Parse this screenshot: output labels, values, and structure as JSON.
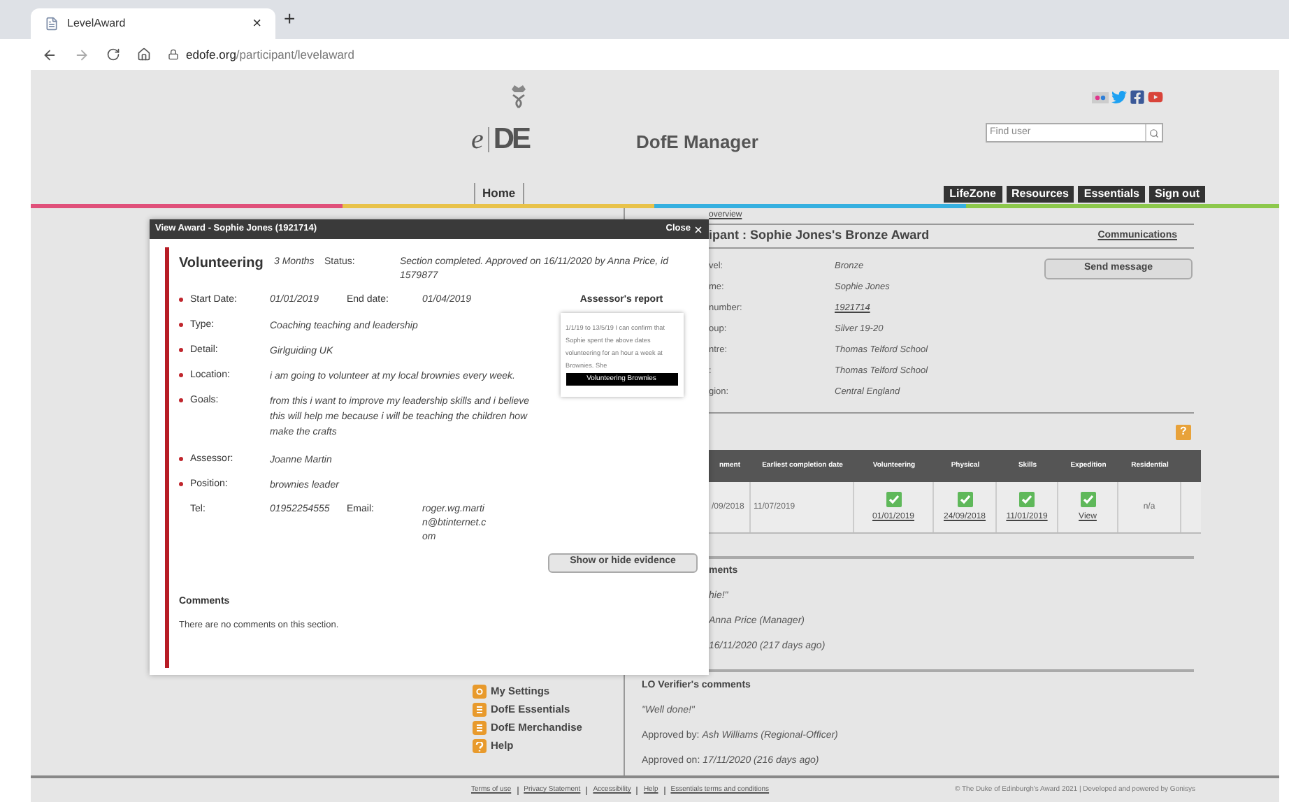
{
  "browser": {
    "tab_title": "LevelAward",
    "close": "×",
    "new_tab": "+",
    "address": {
      "domain": "edofe.org",
      "path": "/participant/levelaward"
    }
  },
  "header": {
    "logo": {
      "letter": "e",
      "mark": "DE"
    },
    "title": "DofE Manager",
    "search": {
      "placeholder": "Find user"
    }
  },
  "nav": {
    "home": "Home",
    "buttons": [
      "LifeZone",
      "Resources",
      "Essentials",
      "Sign out"
    ]
  },
  "breadcrumb": "overview",
  "sidebar": {
    "items": [
      {
        "label": "My Settings",
        "kind": "settings"
      },
      {
        "label": "DofE Essentials",
        "kind": "doc"
      },
      {
        "label": "DofE Merchandise",
        "kind": "doc"
      },
      {
        "label": "Help",
        "kind": "help"
      }
    ]
  },
  "participant": {
    "help_icon": "?",
    "title": "ipant : Sophie Jones's Bronze Award",
    "communications": "Communications",
    "send_message": "Send message",
    "details": [
      {
        "label": "vel:",
        "value": "Bronze",
        "link": false
      },
      {
        "label": "me:",
        "value": "Sophie Jones",
        "link": false
      },
      {
        "label": "number:",
        "value": "1921714",
        "link": true
      },
      {
        "label": "oup:",
        "value": "Silver 19-20",
        "link": false
      },
      {
        "label": "ntre:",
        "value": "Thomas Telford School",
        "link": false
      },
      {
        "label": ":",
        "value": "Thomas Telford School",
        "link": false
      },
      {
        "label": "gion:",
        "value": "Central England",
        "link": false
      }
    ]
  },
  "progress_table": {
    "columns": [
      "nment",
      "Earliest completion date",
      "Volunteering",
      "Physical",
      "Skills",
      "Expedition",
      "Residential"
    ],
    "rows": [
      {
        "cells": [
          {
            "text": "/09/2018",
            "completed": false
          },
          {
            "text": "11/07/2019",
            "completed": false
          },
          {
            "text": "01/01/2019",
            "completed": true
          },
          {
            "text": "24/09/2018",
            "completed": true
          },
          {
            "text": "11/01/2019",
            "completed": true
          },
          {
            "text": "View",
            "completed": true
          },
          {
            "text": "n/a",
            "completed": false
          }
        ]
      }
    ]
  },
  "assessor_comments": {
    "heading": "ments",
    "quote": "hie!\"",
    "approved_by": "Anna Price (Manager)",
    "approved_on": "16/11/2020 (217 days ago)"
  },
  "verifier_comments": {
    "heading": "LO Verifier's comments",
    "quote": "\"Well done!\"",
    "approved_by": "Approved by: *Ash Williams (Regional-Officer)*",
    "approved_on": "Approved on: *17/11/2020 (216 days ago)*"
  },
  "footer": {
    "links": [
      "Terms of use",
      "Privacy Statement",
      "Accessibility",
      "Help",
      "Essentials terms and conditions"
    ],
    "copyright": "© The Duke of Edinburgh's Award 2021 | Developed and powered by Gonisys"
  },
  "modal": {
    "title": "View Award - Sophie Jones (1921714)",
    "close": "Close",
    "section": "Volunteering",
    "duration": "3 Months",
    "status_label": "Status:",
    "status": "Section completed. Approved on 16/11/2020 by Anna Price, id 1579877",
    "top_fields": [
      {
        "label": "Start Date:",
        "value": "01/01/2019",
        "required": true,
        "extra_label": "End date:",
        "extra_value": "01/04/2019"
      },
      {
        "label": "Type:",
        "value": "Coaching teaching and leadership",
        "required": true
      },
      {
        "label": "Detail:",
        "value": "Girlguiding UK",
        "required": true
      },
      {
        "label": "Location:",
        "value": "i am going to volunteer at my local brownies every week.",
        "required": true
      },
      {
        "label": "Goals:",
        "value": "from this i want to improve my leadership skills and i believe this will help me because i will be teaching the children how make the crafts",
        "required": true
      }
    ],
    "bottom_fields": [
      {
        "label": "Assessor:",
        "value": "Joanne Martin",
        "required": true
      },
      {
        "label": "Position:",
        "value": "brownies leader",
        "required": true
      },
      {
        "label": "Tel:",
        "value": "01952254555",
        "required": false,
        "extra_label": "Email:",
        "extra_value": "roger.wg.martin@btinternet.com"
      }
    ],
    "report": {
      "heading": "Assessor's report",
      "text": "1/1/19 to 13/5/19 I can confirm that Sophie spent the above dates volunteering for an hour a week at Brownies. She",
      "caption": "Volunteering Brownies"
    },
    "evidence_button": "Show or hide evidence",
    "comments": {
      "heading": "Comments",
      "text": "There are no comments on this section."
    }
  }
}
